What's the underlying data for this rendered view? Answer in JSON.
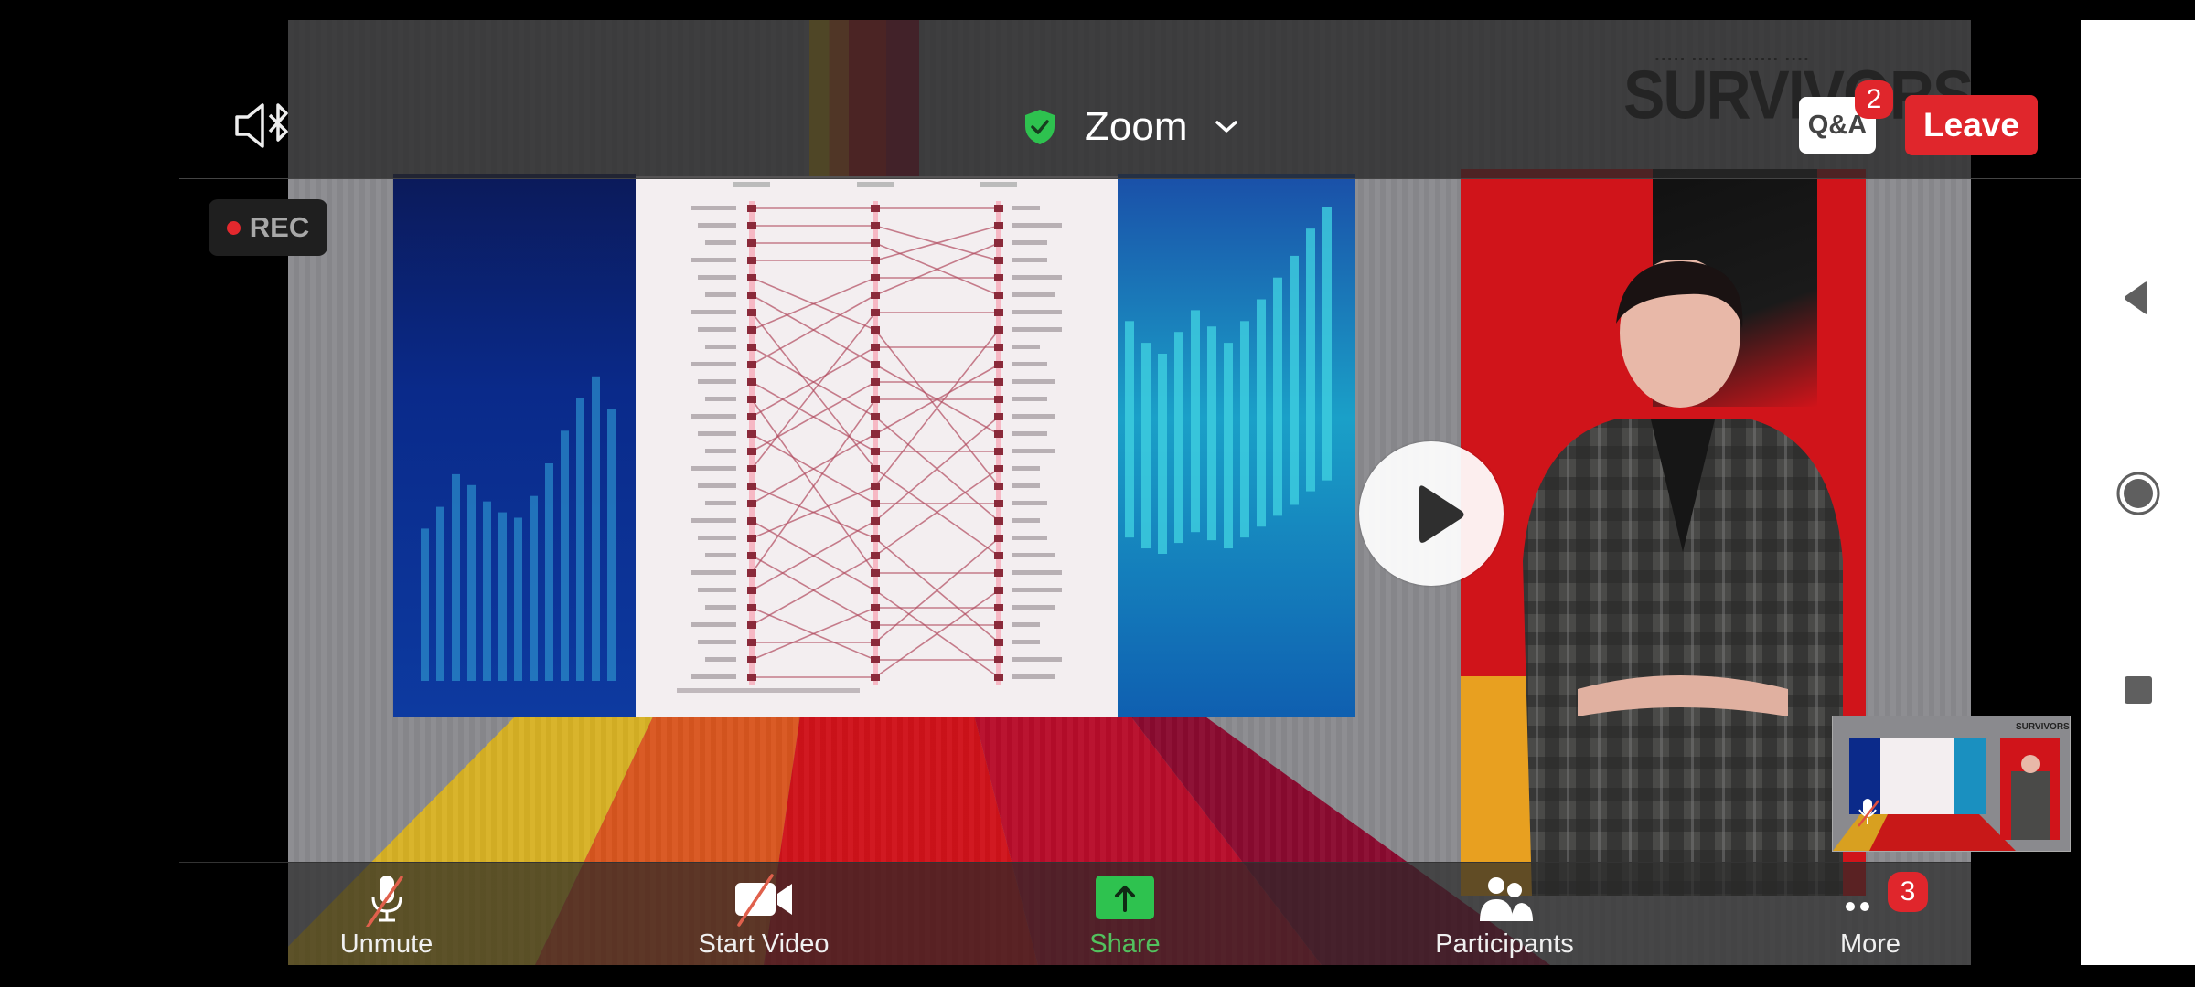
{
  "status_bar": {},
  "top_bar": {
    "audio_icon": "speaker-bluetooth-icon",
    "meeting_name": "Zoom",
    "encryption_icon": "shield-check-icon",
    "encryption_color": "#2ec24f",
    "dropdown_icon": "chevron-down-icon",
    "qa_label": "Q&A",
    "qa_badge": "2",
    "leave_label": "Leave",
    "leave_color": "#e0262c"
  },
  "recording": {
    "label": "REC",
    "dot_color": "#e3282d"
  },
  "video": {
    "stage_title": "SURVIVORS",
    "play_icon": "play-icon",
    "slide_chart": {
      "type": "slope",
      "columns": 3,
      "rows": 28
    }
  },
  "toolbar": {
    "items": [
      {
        "label": "Unmute",
        "icon": "microphone-muted-icon"
      },
      {
        "label": "Start Video",
        "icon": "video-off-icon"
      },
      {
        "label": "Share",
        "icon": "share-screen-icon",
        "color": "#2ec24f"
      },
      {
        "label": "Participants",
        "icon": "participants-icon"
      },
      {
        "label": "More",
        "icon": "more-icon",
        "badge": "3"
      }
    ]
  },
  "nav_bar": {
    "back": "back-icon",
    "home": "home-icon",
    "recents": "recents-icon"
  }
}
